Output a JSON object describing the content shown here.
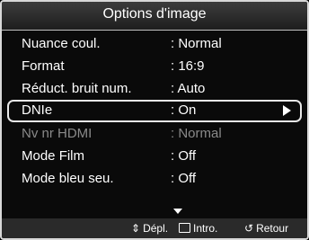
{
  "title": "Options d'image",
  "rows": [
    {
      "label": "Nuance coul.",
      "value": ": Normal"
    },
    {
      "label": "Format",
      "value": ": 16:9"
    },
    {
      "label": "Réduct. bruit num.",
      "value": ": Auto"
    },
    {
      "label": "DNIe",
      "value": ": On",
      "selected": true
    },
    {
      "label": "Nv nr HDMI",
      "value": ": Normal",
      "disabled": true
    },
    {
      "label": "Mode Film",
      "value": ": Off"
    },
    {
      "label": "Mode bleu seu.",
      "value": ": Off"
    }
  ],
  "footer": {
    "move_label": "Dépl.",
    "enter_label": "Intro.",
    "return_label": "Retour",
    "move_icon": "up-down-arrows-icon",
    "enter_icon": "enter-icon",
    "return_icon": "return-icon"
  }
}
